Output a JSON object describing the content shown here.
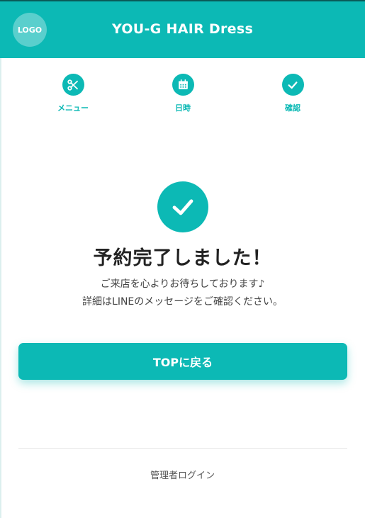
{
  "header": {
    "logo_text": "LOGO",
    "title": "YOU-G HAIR Dress"
  },
  "steps": [
    {
      "label": "メニュー",
      "icon": "scissors-icon"
    },
    {
      "label": "日時",
      "icon": "calendar-icon"
    },
    {
      "label": "確認",
      "icon": "check-icon"
    }
  ],
  "completion": {
    "title": "予約完了しました！",
    "message_line1": "ご来店を心よりお待ちしております♪",
    "message_line2": "詳細はLINEのメッセージをご確認ください。",
    "button_label": "TOPに戻る"
  },
  "footer": {
    "admin_login": "管理者ログイン"
  },
  "colors": {
    "accent": "#0cb9b5",
    "title_text": "#222222"
  }
}
